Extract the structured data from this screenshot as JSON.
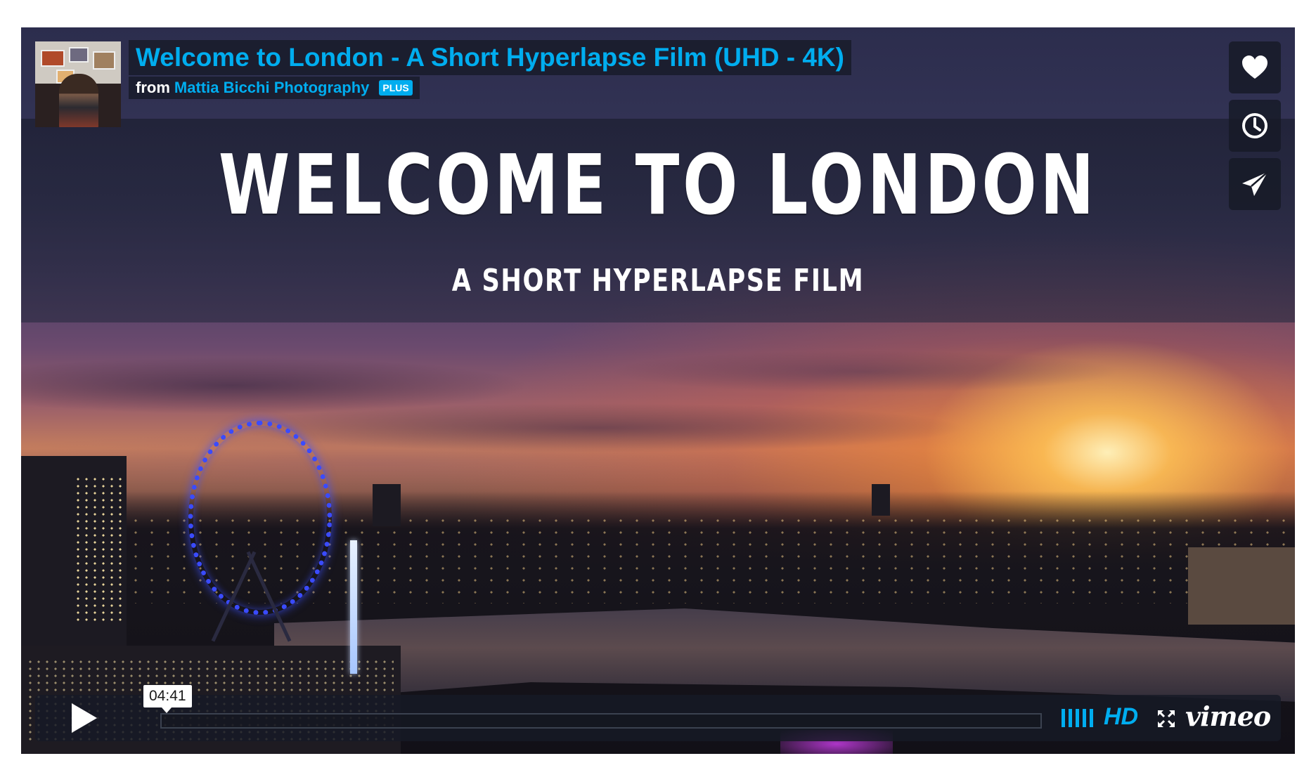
{
  "video": {
    "title": "Welcome to London - A Short Hyperlapse Film (UHD - 4K)",
    "from_label": "from",
    "author": "Mattia Bicchi Photography",
    "badge": "PLUS"
  },
  "frame": {
    "headline": "WELCOME TO LONDON",
    "subheadline": "A SHORT HYPERLAPSE FILM"
  },
  "side_buttons": [
    {
      "icon": "heart-icon"
    },
    {
      "icon": "clock-icon"
    },
    {
      "icon": "send-icon"
    }
  ],
  "controls": {
    "duration": "04:41",
    "progress": 0,
    "quality": "HD",
    "brand": "vimeo"
  },
  "colors": {
    "accent": "#00adef",
    "overlay": "#161a26"
  }
}
